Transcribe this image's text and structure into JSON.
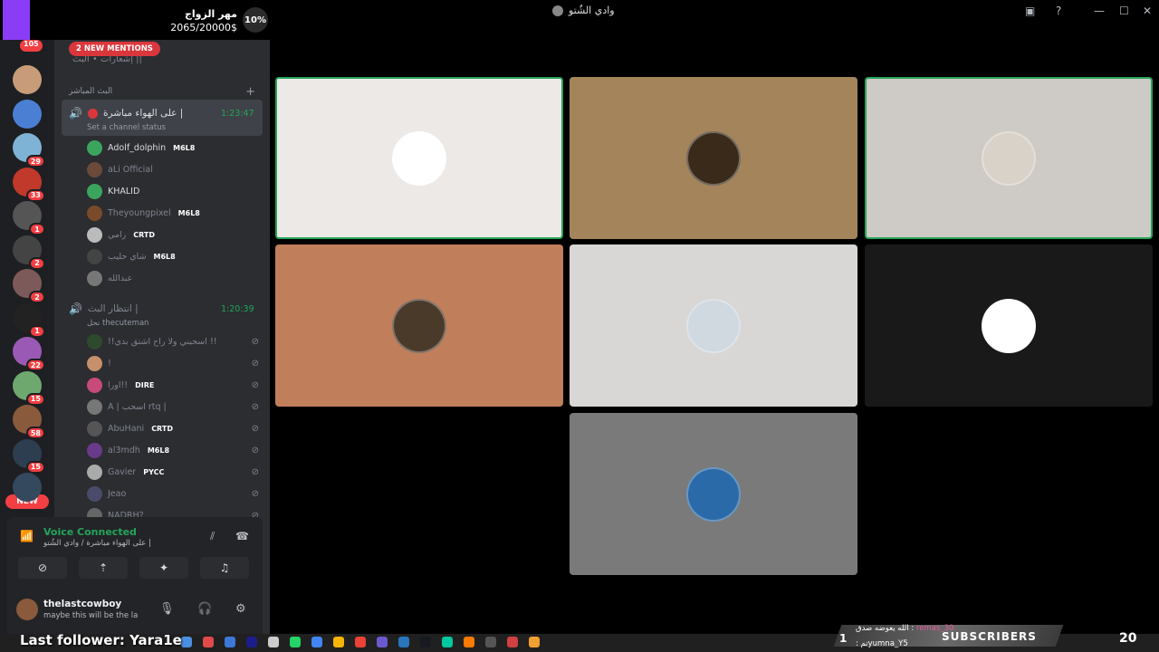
{
  "window": {
    "title": "وادي الشُتو"
  },
  "goal": {
    "title": "مهر الزواج",
    "amount": "2065/20000$",
    "percent": "10%"
  },
  "rail": {
    "top_badge": "105",
    "servers": [
      {
        "color": "#c89c78",
        "badge": ""
      },
      {
        "color": "#4a7fd4",
        "badge": ""
      },
      {
        "color": "#7fb3d5",
        "badge": "29"
      },
      {
        "color": "#c0392b",
        "badge": "33"
      },
      {
        "color": "#555555",
        "badge": "1"
      },
      {
        "color": "#444444",
        "badge": "2"
      },
      {
        "color": "#7d5a5a",
        "badge": "2"
      },
      {
        "color": "#222222",
        "badge": "1"
      },
      {
        "color": "#9b59b6",
        "badge": "22"
      },
      {
        "color": "#6fa86f",
        "badge": "15"
      },
      {
        "color": "#8a5a3c",
        "badge": "58"
      },
      {
        "color": "#2c3e50",
        "badge": "15"
      },
      {
        "color": "#34495e",
        "badge": ""
      }
    ],
    "new_label": "NEW"
  },
  "sidebar": {
    "top_channel": "إشعارات • البث ||",
    "mentions_label": "2 NEW MENTIONS",
    "category": "البث المباشر",
    "active_channel": {
      "name": "على الهواء مباشرة |",
      "time": "1:23:47",
      "status": "Set a channel status"
    },
    "active_members": [
      {
        "name": "Adolf_dolphin",
        "tag": "M6L8",
        "color": "#3ba55d",
        "bright": true
      },
      {
        "name": "aLi Official",
        "tag": "",
        "color": "#6b4a3a",
        "bright": false
      },
      {
        "name": "KHALID",
        "tag": "",
        "color": "#3ba55d",
        "bright": true
      },
      {
        "name": "Theyoungpixel",
        "tag": "M6L8",
        "color": "#7a4a2a",
        "bright": false
      },
      {
        "name": "رامي",
        "tag": "CRTD",
        "color": "#bbbbbb",
        "bright": false
      },
      {
        "name": "شاي حليب",
        "tag": "M6L8",
        "color": "#444444",
        "bright": false
      },
      {
        "name": "عبدالله",
        "tag": "",
        "color": "#777777",
        "bright": false
      }
    ],
    "waiting_channel": {
      "name": "انتظار البث |",
      "time": "1:20:39",
      "status": "نحل thecuteman"
    },
    "waiting_members": [
      {
        "name": "!!اسحبني ولا راح اشتق بدي !!",
        "tag": "",
        "color": "#2d4a2d"
      },
      {
        "name": "!",
        "tag": "",
        "color": "#c8906a"
      },
      {
        "name": "اورا!!",
        "tag": "DIRE",
        "color": "#c74a7a"
      },
      {
        "name": "A | اسحب rtq |",
        "tag": "",
        "color": "#777777"
      },
      {
        "name": "AbuHani",
        "tag": "CRTD",
        "color": "#555555"
      },
      {
        "name": "al3mdh",
        "tag": "M6L8",
        "color": "#6a3a8a"
      },
      {
        "name": "Gavier",
        "tag": "PYCC",
        "color": "#aaaaaa"
      },
      {
        "name": "Jeao",
        "tag": "",
        "color": "#4a4a6a"
      },
      {
        "name": "NADRH?",
        "tag": "",
        "color": "#666666"
      }
    ]
  },
  "voice": {
    "title": "Voice Connected",
    "subtitle": "على الهواء مباشرة / وادي الشُتو |"
  },
  "user": {
    "name": "thelastcowboy",
    "status": "maybe this will be the la"
  },
  "tiles": [
    {
      "bg": "#ece9e6",
      "face": "#ffffff",
      "speaking": true
    },
    {
      "bg": "#a3845b",
      "face": "#3a2a1a",
      "speaking": false
    },
    {
      "bg": "#cecac6",
      "face": "#d8d2c8",
      "speaking": true
    },
    {
      "bg": "#c17e5b",
      "face": "#4a3a2a",
      "speaking": false
    },
    {
      "bg": "#d8d7d5",
      "face": "#d0d8e0",
      "speaking": false
    },
    {
      "bg": "#191919",
      "face": "#ffffff",
      "speaking": false
    },
    {
      "bg": "#7a7a7a",
      "face": "#2a6aa8",
      "speaking": false
    }
  ],
  "overlay": {
    "last_follower": "Last follower: Yara1e",
    "subscribers_label": "SUBSCRIBERS",
    "sub1_user": "remas_30",
    "sub1_text": "الله يعوضه صدق : ",
    "sub2_user": "yumna_Y5",
    "sub2_text": " : تم",
    "sub_count": "1",
    "clock": "20"
  }
}
